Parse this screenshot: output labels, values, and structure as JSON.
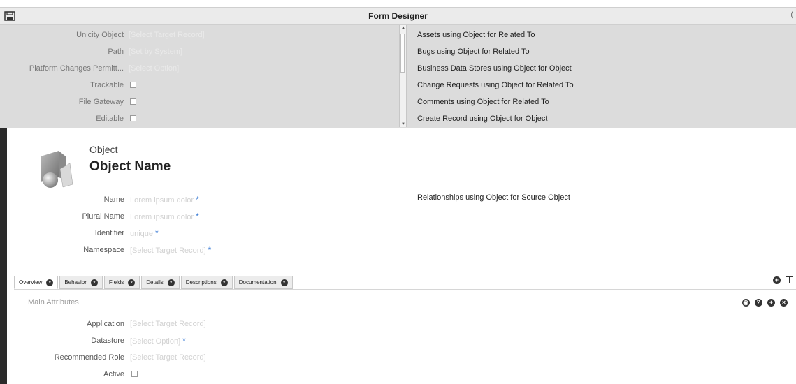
{
  "window": {
    "title": "Form Designer"
  },
  "overlay_form": {
    "fields": [
      {
        "label": "Unicity Object",
        "value": "[Select Target Record]",
        "type": "text"
      },
      {
        "label": "Path",
        "value": "[Set by System]",
        "type": "text"
      },
      {
        "label": "Platform Changes Permitt...",
        "value": "[Select Option]",
        "type": "text"
      },
      {
        "label": "Trackable",
        "type": "checkbox",
        "checked": false
      },
      {
        "label": "File Gateway",
        "type": "checkbox",
        "checked": false
      },
      {
        "label": "Editable",
        "type": "checkbox",
        "checked": false
      }
    ]
  },
  "related_list": [
    "Assets using Object for Related To",
    "Bugs using Object for Related To",
    "Business Data Stores using Object for Object",
    "Change Requests using Object for Related To",
    "Comments using Object for Related To",
    "Create Record using Object for Object"
  ],
  "record": {
    "type_label": "Object",
    "name": "Object Name"
  },
  "main_fields": [
    {
      "label": "Name",
      "value": "Lorem ipsum dolor",
      "required": "*"
    },
    {
      "label": "Plural Name",
      "value": "Lorem ipsum dolor",
      "required": "*"
    },
    {
      "label": "Identifier",
      "value": "unique",
      "required": "*"
    },
    {
      "label": "Namespace",
      "value": "[Select Target Record]",
      "required": "*"
    }
  ],
  "relationship_note": "Relationships using Object for Source Object",
  "tabs": [
    "Overview",
    "Behavior",
    "Fields",
    "Details",
    "Descriptions",
    "Documentation"
  ],
  "section": {
    "title": "Main Attributes"
  },
  "section_fields": [
    {
      "label": "Application",
      "value": "[Select Target Record]",
      "required": ""
    },
    {
      "label": "Datastore",
      "value": "[Select Option]",
      "required": "*"
    },
    {
      "label": "Recommended Role",
      "value": "[Select Target Record]",
      "required": ""
    },
    {
      "label": "Active",
      "type": "checkbox",
      "checked": false
    }
  ],
  "colors": {
    "required_star": "#3a7bd5",
    "panel_border": "#2b2b2b"
  }
}
